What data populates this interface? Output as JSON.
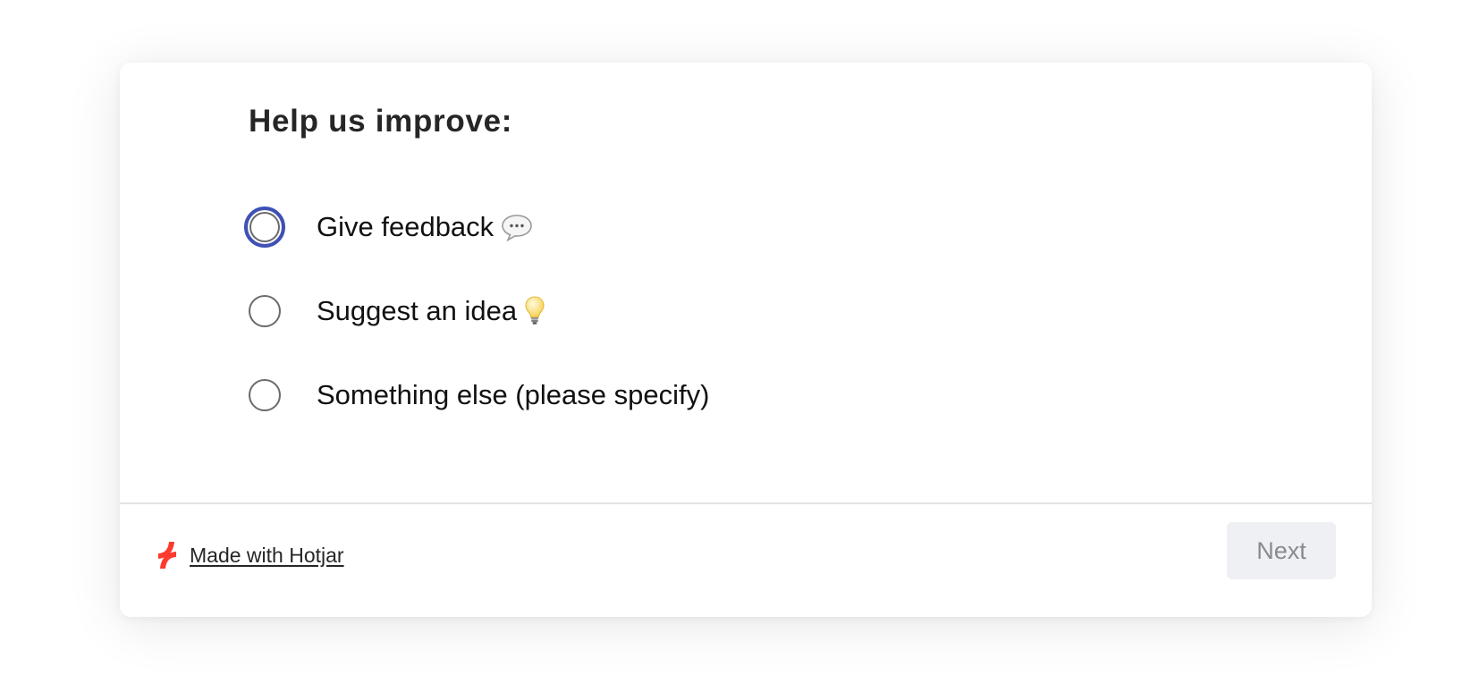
{
  "survey": {
    "title": "Help us improve:",
    "options": [
      {
        "label": "Give feedback",
        "icon": "speech-bubble-icon",
        "focused": true,
        "selected": false
      },
      {
        "label": "Suggest an idea",
        "icon": "light-bulb-icon",
        "focused": false,
        "selected": false
      },
      {
        "label": "Something else (please specify)",
        "icon": null,
        "focused": false,
        "selected": false
      }
    ]
  },
  "footer": {
    "brand_label": "Made with Hotjar",
    "brand_icon": "hotjar-logo-icon",
    "next_label": "Next",
    "next_disabled": true
  },
  "colors": {
    "focus_ring": "#3f51b5",
    "brand_accent": "#fd3a2e",
    "button_bg": "#eff0f3",
    "button_text": "#888a8f"
  }
}
